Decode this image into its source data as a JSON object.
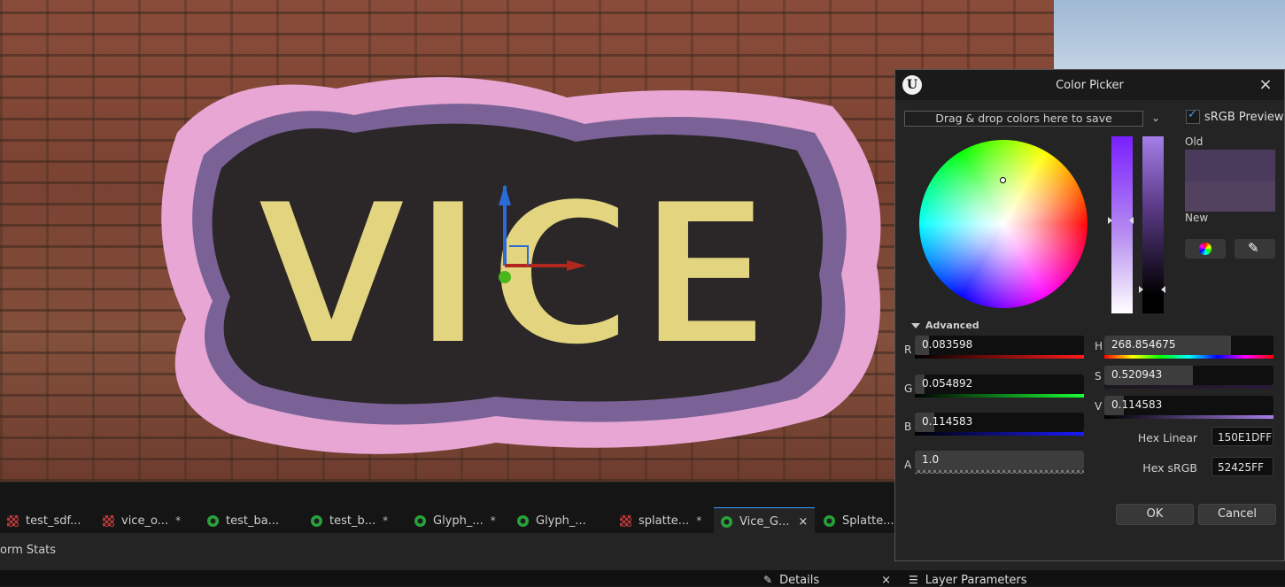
{
  "colors": {
    "old": "#4a3a5c",
    "new": "#52425f",
    "accent": "#3aa0ff"
  },
  "viewport": {
    "graffiti_text": "VICE"
  },
  "tabs": [
    {
      "label": "test_sdf...",
      "icon": "texture-icon",
      "modified": "",
      "active": false
    },
    {
      "label": "vice_o...",
      "icon": "texture-icon",
      "modified": "*",
      "active": false
    },
    {
      "label": "test_ba...",
      "icon": "material-icon",
      "modified": "",
      "active": false
    },
    {
      "label": "test_b...",
      "icon": "material-icon",
      "modified": "*",
      "active": false
    },
    {
      "label": "Glyph_...",
      "icon": "material-icon",
      "modified": "*",
      "active": false
    },
    {
      "label": "Glyph_...",
      "icon": "material-icon",
      "modified": "",
      "active": false
    },
    {
      "label": "splatte...",
      "icon": "texture-icon",
      "modified": "*",
      "active": false
    },
    {
      "label": "Vice_G...",
      "icon": "material-icon",
      "modified": "",
      "active": true,
      "close": "×"
    },
    {
      "label": "Splatte...",
      "icon": "material-icon",
      "modified": "*",
      "active": false
    }
  ],
  "stats_label": "orm Stats",
  "bottom_panels": {
    "details": "Details",
    "details_close": "×",
    "layer_parameters": "Layer Parameters"
  },
  "picker": {
    "title": "Color Picker",
    "close": "×",
    "swatch_drop": "Drag & drop colors here to save",
    "srgb_preview": "sRGB Preview",
    "old_label": "Old",
    "new_label": "New",
    "advanced": "Advanced",
    "rgba": [
      {
        "label": "R",
        "value": "0.083598",
        "level": 0.084
      },
      {
        "label": "G",
        "value": "0.054892",
        "level": 0.055
      },
      {
        "label": "B",
        "value": "0.114583",
        "level": 0.115
      },
      {
        "label": "A",
        "value": "1.0",
        "level": 1.0
      }
    ],
    "hsv": [
      {
        "label": "H",
        "value": "268.854675",
        "level": 0.747
      },
      {
        "label": "S",
        "value": "0.520943",
        "level": 0.521
      },
      {
        "label": "V",
        "value": "0.114583",
        "level": 0.115
      }
    ],
    "hex_linear_label": "Hex Linear",
    "hex_linear": "150E1DFF",
    "hex_srgb_label": "Hex sRGB",
    "hex_srgb": "52425FF",
    "ok": "OK",
    "cancel": "Cancel"
  }
}
